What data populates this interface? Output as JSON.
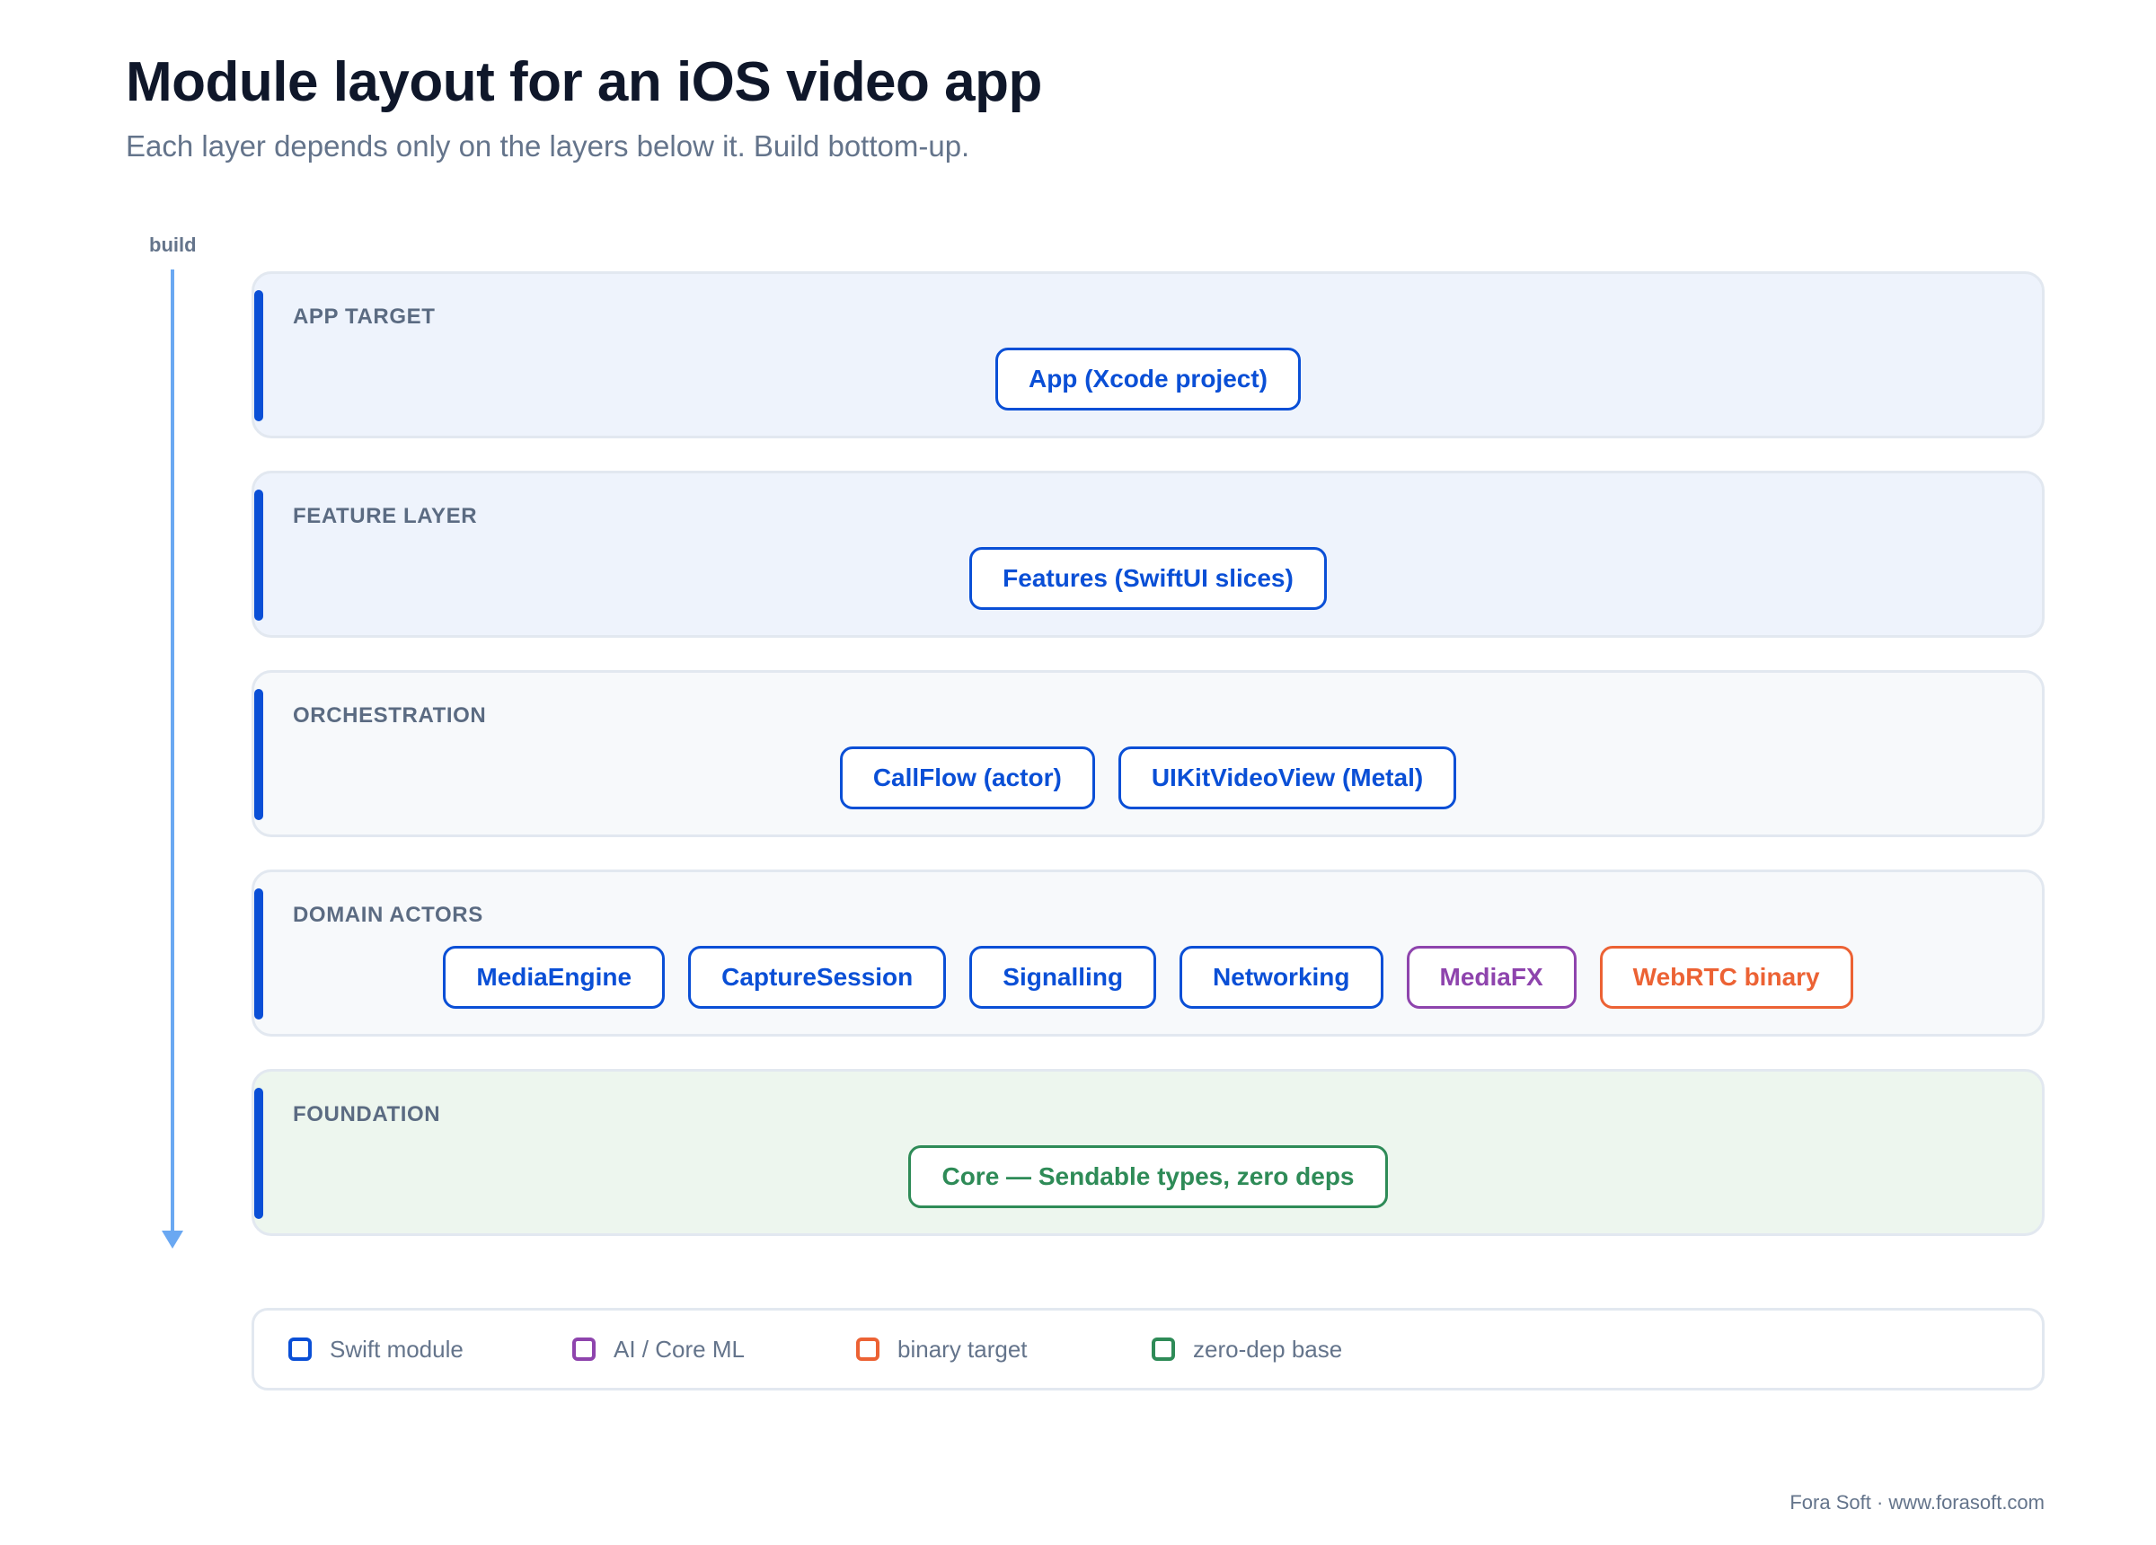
{
  "title": "Module layout for an iOS video app",
  "subtitle": "Each layer depends only on the layers below it. Build bottom-up.",
  "build_label": "build",
  "colors": {
    "swift": "#0a4fd6",
    "ai": "#8e44ad",
    "binary": "#ec6234",
    "zero_dep": "#2e8b57"
  },
  "layers": [
    {
      "label": "APP TARGET",
      "modules": [
        {
          "name": "App (Xcode project)",
          "kind": "swift"
        }
      ]
    },
    {
      "label": "FEATURE LAYER",
      "modules": [
        {
          "name": "Features (SwiftUI slices)",
          "kind": "swift"
        }
      ]
    },
    {
      "label": "ORCHESTRATION",
      "modules": [
        {
          "name": "CallFlow (actor)",
          "kind": "swift"
        },
        {
          "name": "UIKitVideoView (Metal)",
          "kind": "swift"
        }
      ]
    },
    {
      "label": "DOMAIN ACTORS",
      "modules": [
        {
          "name": "MediaEngine",
          "kind": "swift"
        },
        {
          "name": "CaptureSession",
          "kind": "swift"
        },
        {
          "name": "Signalling",
          "kind": "swift"
        },
        {
          "name": "Networking",
          "kind": "swift"
        },
        {
          "name": "MediaFX",
          "kind": "ai"
        },
        {
          "name": "WebRTC binary",
          "kind": "binary"
        }
      ]
    },
    {
      "label": "FOUNDATION",
      "modules": [
        {
          "name": "Core — Sendable types, zero deps",
          "kind": "zero_dep"
        }
      ]
    }
  ],
  "legend": [
    {
      "label": "Swift module",
      "kind": "swift"
    },
    {
      "label": "AI / Core ML",
      "kind": "ai"
    },
    {
      "label": "binary target",
      "kind": "binary"
    },
    {
      "label": "zero-dep base",
      "kind": "zero_dep"
    }
  ],
  "footer": "Fora Soft · www.forasoft.com"
}
